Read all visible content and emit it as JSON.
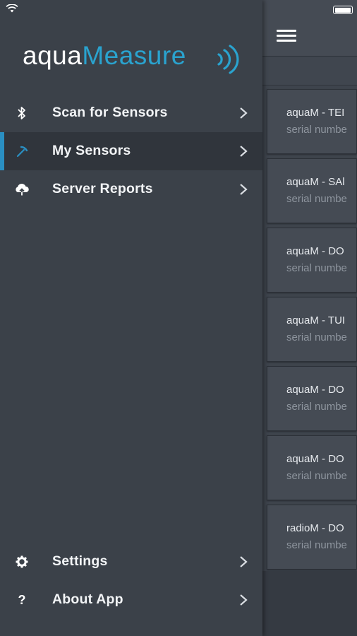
{
  "app": {
    "logo_primary": "aqua",
    "logo_secondary": "Measure",
    "brand_color": "#2aa3cf",
    "accent_color": "#2a8fc2"
  },
  "status_bar": {
    "icons": [
      "wifi-icon",
      "battery-icon"
    ]
  },
  "drawer": {
    "items": [
      {
        "label": "Scan for Sensors",
        "icon": "bluetooth-icon",
        "active": false
      },
      {
        "label": "My Sensors",
        "icon": "pickaxe-icon",
        "active": true
      },
      {
        "label": "Server Reports",
        "icon": "cloud-upload-icon",
        "active": false
      }
    ],
    "bottom_items": [
      {
        "label": "Settings",
        "icon": "gear-icon"
      },
      {
        "label": "About App",
        "icon": "question-icon"
      }
    ]
  },
  "main": {
    "menu_icon": "hamburger-menu-icon",
    "sensors": [
      {
        "name": "aquaM - TEI",
        "serial": "serial numbe"
      },
      {
        "name": "aquaM - SAl",
        "serial": "serial numbe"
      },
      {
        "name": "aquaM - DO",
        "serial": "serial numbe"
      },
      {
        "name": "aquaM - TUI",
        "serial": "serial numbe"
      },
      {
        "name": "aquaM - DO",
        "serial": "serial numbe"
      },
      {
        "name": "aquaM - DO",
        "serial": "serial numbe"
      },
      {
        "name": "radioM - DO",
        "serial": "serial numbe"
      }
    ]
  }
}
